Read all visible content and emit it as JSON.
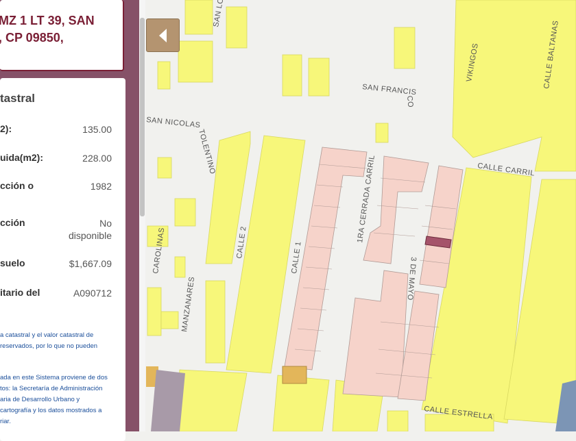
{
  "address": {
    "title_line1": "MZ 1 LT 39, SAN",
    "title_line2": ", CP 09850,"
  },
  "info": {
    "section_title": "tastral",
    "rows": [
      {
        "label": "2):",
        "value": "135.00"
      },
      {
        "label": "uida(m2):",
        "value": "228.00"
      },
      {
        "label": "cción o",
        "value": "1982"
      },
      {
        "label": "cción",
        "value": "No disponible"
      },
      {
        "label": "suelo",
        "value": "$1,667.09"
      },
      {
        "label": "itario del",
        "value": "A090712"
      }
    ],
    "note1": [
      "a catastral y el valor catastral de",
      "reservados, por lo que no pueden"
    ],
    "note2": [
      "ada en este Sistema proviene de dos",
      "tos: la Secretaría de Administración",
      "aria de Desarrollo Urbano y",
      " cartografía y los datos mostrados a",
      "riar."
    ]
  },
  "map": {
    "back_button_icon": "chevron-left-icon",
    "colors": {
      "block": "#f7f77a",
      "lot": "#f6d3ca",
      "selected_lot": "#a5536a",
      "background": "#f1f1ee"
    },
    "streets": [
      "SAN LO",
      "VIKINGOS",
      "CALLE BALTANAS",
      "SAN FRANCIS",
      "CO",
      "SAN NICOLAS",
      "TOLENTINO",
      "CALLE CARRIL",
      "1RA CERRADA CARRIL",
      "CALLE 2",
      "CALLE 1",
      "3 DE MAYO",
      "CAROLINAS",
      "MANZANARES",
      "CALLE ESTRELLA"
    ]
  }
}
